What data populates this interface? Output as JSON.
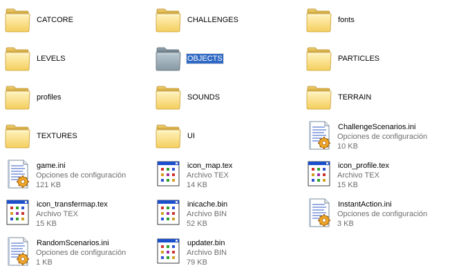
{
  "window": {
    "view": "Tiles"
  },
  "items": [
    {
      "name": "CATCORE",
      "kind": "folder"
    },
    {
      "name": "CHALLENGES",
      "kind": "folder"
    },
    {
      "name": "fonts",
      "kind": "folder"
    },
    {
      "name": "LEVELS",
      "kind": "folder"
    },
    {
      "name": "OBJECTS",
      "kind": "folder",
      "selected": true
    },
    {
      "name": "PARTICLES",
      "kind": "folder"
    },
    {
      "name": "profiles",
      "kind": "folder"
    },
    {
      "name": "SOUNDS",
      "kind": "folder"
    },
    {
      "name": "TERRAIN",
      "kind": "folder"
    },
    {
      "name": "TEXTURES",
      "kind": "folder"
    },
    {
      "name": "UI",
      "kind": "folder"
    },
    {
      "name": "ChallengeScenarios.ini",
      "type": "Opciones de configuración",
      "size": "10 KB",
      "kind": "ini"
    },
    {
      "name": "game.ini",
      "type": "Opciones de configuración",
      "size": "121 KB",
      "kind": "ini"
    },
    {
      "name": "icon_map.tex",
      "type": "Archivo TEX",
      "size": "14 KB",
      "kind": "bin"
    },
    {
      "name": "icon_profile.tex",
      "type": "Archivo TEX",
      "size": "15 KB",
      "kind": "bin"
    },
    {
      "name": "icon_transfermap.tex",
      "type": "Archivo TEX",
      "size": "15 KB",
      "kind": "bin"
    },
    {
      "name": "inicache.bin",
      "type": "Archivo BIN",
      "size": "52 KB",
      "kind": "bin"
    },
    {
      "name": "InstantAction.ini",
      "type": "Opciones de configuración",
      "size": "3 KB",
      "kind": "ini"
    },
    {
      "name": "RandomScenarios.ini",
      "type": "Opciones de configuración",
      "size": "1 KB",
      "kind": "ini"
    },
    {
      "name": "updater.bin",
      "type": "Archivo BIN",
      "size": "79 KB",
      "kind": "bin"
    }
  ]
}
